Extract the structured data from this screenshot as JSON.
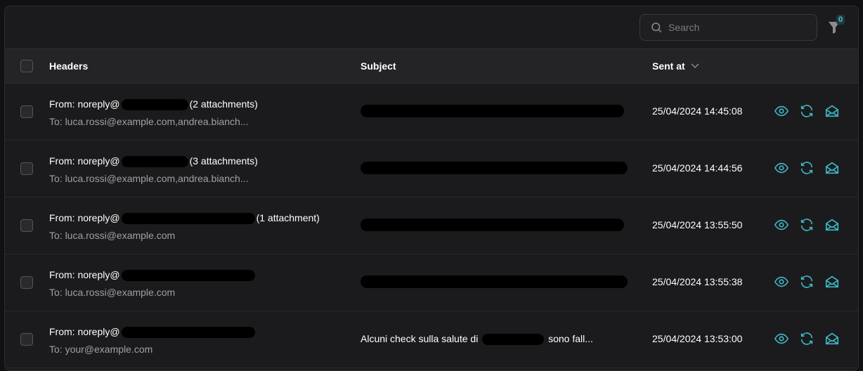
{
  "search": {
    "placeholder": "Search"
  },
  "filter": {
    "count": "0"
  },
  "columns": {
    "headers": "Headers",
    "subject": "Subject",
    "sent_at": "Sent at"
  },
  "accent": "#3fb8c4",
  "rows": [
    {
      "from": "From: noreply@",
      "attachments": "(2 attachments)",
      "to": "To: luca.rossi@example.com,andrea.bianch...",
      "subject": "",
      "sent": "25/04/2024 14:45:08"
    },
    {
      "from": "From: noreply@",
      "attachments": "(3 attachments)",
      "to": "To: luca.rossi@example.com,andrea.bianch...",
      "subject": "",
      "sent": "25/04/2024 14:44:56"
    },
    {
      "from": "From: noreply@",
      "attachments": "(1 attachment)",
      "to": "To: luca.rossi@example.com",
      "subject": "",
      "sent": "25/04/2024 13:55:50"
    },
    {
      "from": "From: noreply@",
      "attachments": "",
      "to": "To: luca.rossi@example.com",
      "subject": "",
      "sent": "25/04/2024 13:55:38"
    },
    {
      "from": "From: noreply@",
      "attachments": "",
      "to": "To: your@example.com",
      "subject_pre": "Alcuni check sulla salute di",
      "subject_post": "sono fall...",
      "sent": "25/04/2024 13:53:00"
    }
  ]
}
